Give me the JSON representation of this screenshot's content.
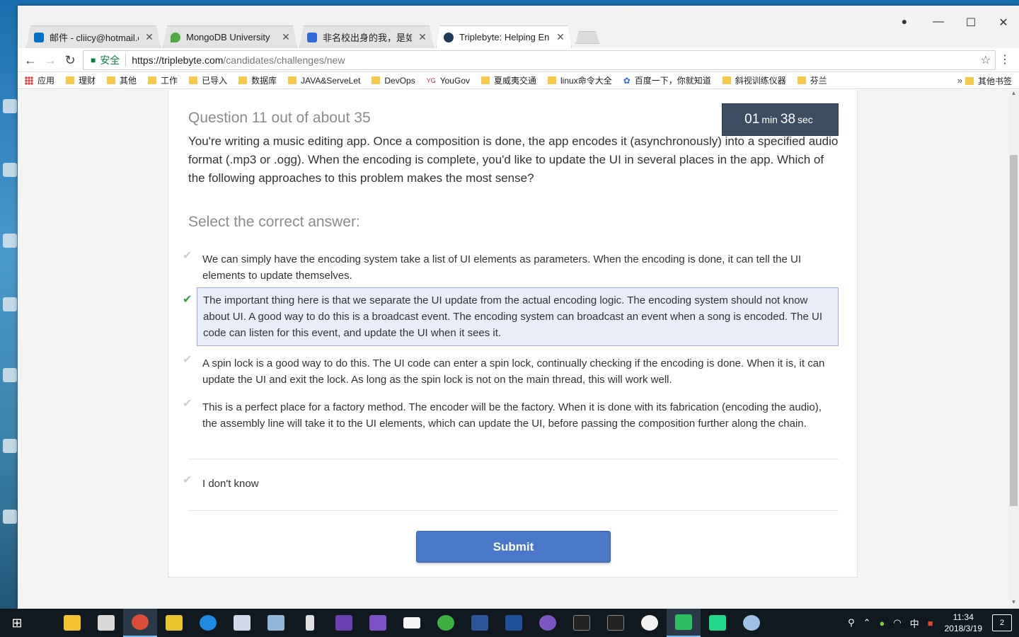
{
  "browser": {
    "tabs": [
      {
        "title": "邮件 - cliicy@hotmail.c",
        "favicon_color": "#0072c6"
      },
      {
        "title": "MongoDB University",
        "favicon_color": "#4faa41"
      },
      {
        "title": "非名校出身的我，是如何",
        "favicon_color": "#2e6bd9"
      },
      {
        "title": "Triplebyte: Helping Eng",
        "favicon_color": "#1f3a5a"
      }
    ],
    "tab_close_glyph": "✕",
    "window_controls": {
      "minimize": "—",
      "maximize": "☐",
      "close": "✕"
    },
    "nav": {
      "back": "←",
      "forward": "→",
      "reload": "↻"
    },
    "address": {
      "secure_label": "安全",
      "url_host": "https://triplebyte.com",
      "url_path": "/candidates/challenges/new"
    },
    "bookmarks": [
      {
        "label": "应用",
        "kind": "apps"
      },
      {
        "label": "理财",
        "kind": "folder"
      },
      {
        "label": "其他",
        "kind": "folder"
      },
      {
        "label": "工作",
        "kind": "folder"
      },
      {
        "label": "已导入",
        "kind": "folder"
      },
      {
        "label": "数据库",
        "kind": "folder"
      },
      {
        "label": "JAVA&ServeLet",
        "kind": "folder"
      },
      {
        "label": "DevOps",
        "kind": "folder"
      },
      {
        "label": "YouGov",
        "kind": "site"
      },
      {
        "label": "夏威夷交通",
        "kind": "folder"
      },
      {
        "label": "linux命令大全",
        "kind": "folder"
      },
      {
        "label": "百度一下，你就知道",
        "kind": "site"
      },
      {
        "label": "斜视训练仪器",
        "kind": "folder"
      },
      {
        "label": "芬兰",
        "kind": "folder"
      }
    ],
    "bookmarks_more": "»",
    "other_bookmarks": "其他书签"
  },
  "quiz": {
    "question_header": "Question 11 out of about 35",
    "timer": {
      "minutes": "01",
      "min_label": "min",
      "seconds": "38",
      "sec_label": "sec"
    },
    "question_text": "You're writing a music editing app. Once a composition is done, the app encodes it (asynchronously) into a specified audio format (.mp3 or .ogg). When the encoding is complete, you'd like to update the UI in several places in the app. Which of the following approaches to this problem makes the most sense?",
    "select_label": "Select the correct answer:",
    "answers": [
      {
        "text": "We can simply have the encoding system take a list of UI elements as parameters. When the encoding is done, it can tell the UI elements to update themselves.",
        "selected": false
      },
      {
        "text": "The important thing here is that we separate the UI update from the actual encoding logic. The encoding system should not know about UI. A good way to do this is a broadcast event. The encoding system can broadcast an event when a song is encoded. The UI code can listen for this event, and update the UI when it sees it.",
        "selected": true
      },
      {
        "text": "A spin lock is a good way to do this. The UI code can enter a spin lock, continually checking if the encoding is done. When it is, it can update the UI and exit the lock. As long as the spin lock is not on the main thread, this will work well.",
        "selected": false
      },
      {
        "text": "This is a perfect place for a factory method. The encoder will be the factory. When it is done with its fabrication (encoding the audio), the assembly line will take it to the UI elements, which can update the UI, before passing the composition further along the chain.",
        "selected": false
      }
    ],
    "dont_know": "I don't know",
    "check_glyph": "✔",
    "submit_label": "Submit"
  },
  "taskbar": {
    "clock_time": "11:34",
    "clock_date": "2018/3/19",
    "ime": "中",
    "notifications": "2"
  },
  "colors": {
    "accent": "#4a78c8",
    "timer_bg": "#3d4d62",
    "selected_bg": "#e8edf8",
    "check_selected": "#3a9a4b"
  }
}
